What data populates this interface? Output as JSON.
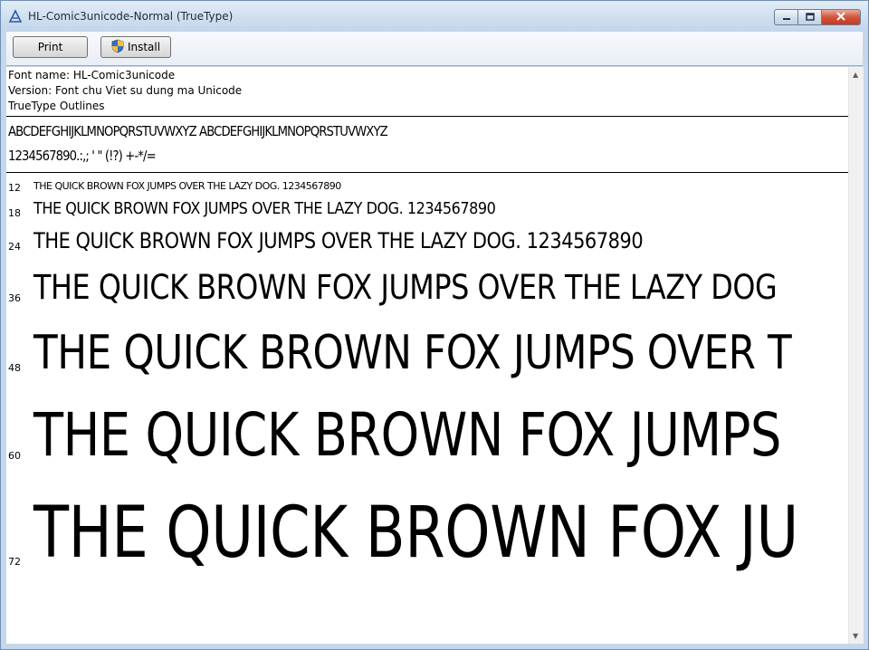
{
  "window": {
    "title": "HL-Comic3unicode-Normal (TrueType)",
    "icon": "font-file-icon",
    "controls": [
      "minimize-icon",
      "maximize-icon",
      "close-icon"
    ]
  },
  "toolbar": {
    "print_label": "Print",
    "install_label": "Install",
    "install_icon": "shield-icon"
  },
  "font_info": {
    "name": "Font name: HL-Comic3unicode",
    "version": "Version: Font chu Viet su dung ma Unicode",
    "type": "TrueType Outlines"
  },
  "charset": {
    "letters": "ABCDEFGHIJKLMNOPQRSTUVWXYZ ABCDEFGHIJKLMNOPQRSTUVWXYZ",
    "symbols": "1234567890.:,; ' \" (!?) +-*/="
  },
  "samples": [
    {
      "size": "12",
      "text": "THE QUICK BROWN FOX JUMPS OVER THE LAZY DOG. 1234567890"
    },
    {
      "size": "18",
      "text": "THE QUICK BROWN FOX JUMPS OVER THE LAZY DOG. 1234567890"
    },
    {
      "size": "24",
      "text": "THE QUICK BROWN FOX JUMPS OVER THE LAZY DOG. 1234567890"
    },
    {
      "size": "36",
      "text": "THE QUICK BROWN FOX JUMPS OVER THE LAZY DOG"
    },
    {
      "size": "48",
      "text": "THE QUICK BROWN FOX JUMPS OVER T"
    },
    {
      "size": "60",
      "text": "THE QUICK BROWN FOX JUMPS"
    },
    {
      "size": "72",
      "text": "THE QUICK BROWN FOX JU"
    }
  ],
  "colors": {
    "titlebar": "#cfdff0",
    "close_button": "#c33b20",
    "toolbar": "#e9eef5"
  }
}
